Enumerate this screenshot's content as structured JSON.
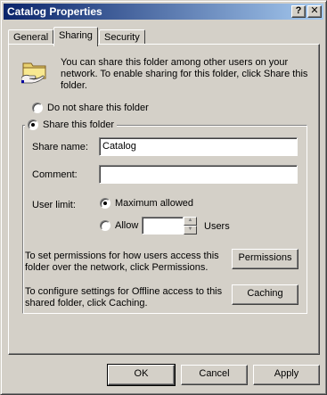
{
  "window": {
    "title": "Catalog Properties",
    "help_glyph": "?",
    "close_glyph": "✕"
  },
  "tabs": [
    {
      "label": "General",
      "active": false
    },
    {
      "label": "Sharing",
      "active": true
    },
    {
      "label": "Security",
      "active": false
    }
  ],
  "sharing": {
    "icon": "shared-folder-icon",
    "intro": "You can share this folder among other users on your network.  To enable sharing for this folder, click Share this folder.",
    "do_not_share_label": "Do not share this folder",
    "share_label": "Share this folder",
    "share_selected": true,
    "share_name_label": "Share name:",
    "share_name_value": "Catalog",
    "comment_label": "Comment:",
    "comment_value": "",
    "user_limit_label": "User limit:",
    "max_allowed_label": "Maximum allowed",
    "allow_label": "Allow",
    "allow_value": "",
    "users_label": "Users",
    "permissions_text": "To set permissions for how users access this folder over the network, click Permissions.",
    "permissions_button": "Permissions",
    "caching_text": "To configure settings for Offline access to this shared folder, click Caching.",
    "caching_button": "Caching"
  },
  "footer": {
    "ok": "OK",
    "cancel": "Cancel",
    "apply": "Apply"
  },
  "colors": {
    "title_start": "#0a246a",
    "title_end": "#a6caf0",
    "face": "#d4d0c8"
  }
}
